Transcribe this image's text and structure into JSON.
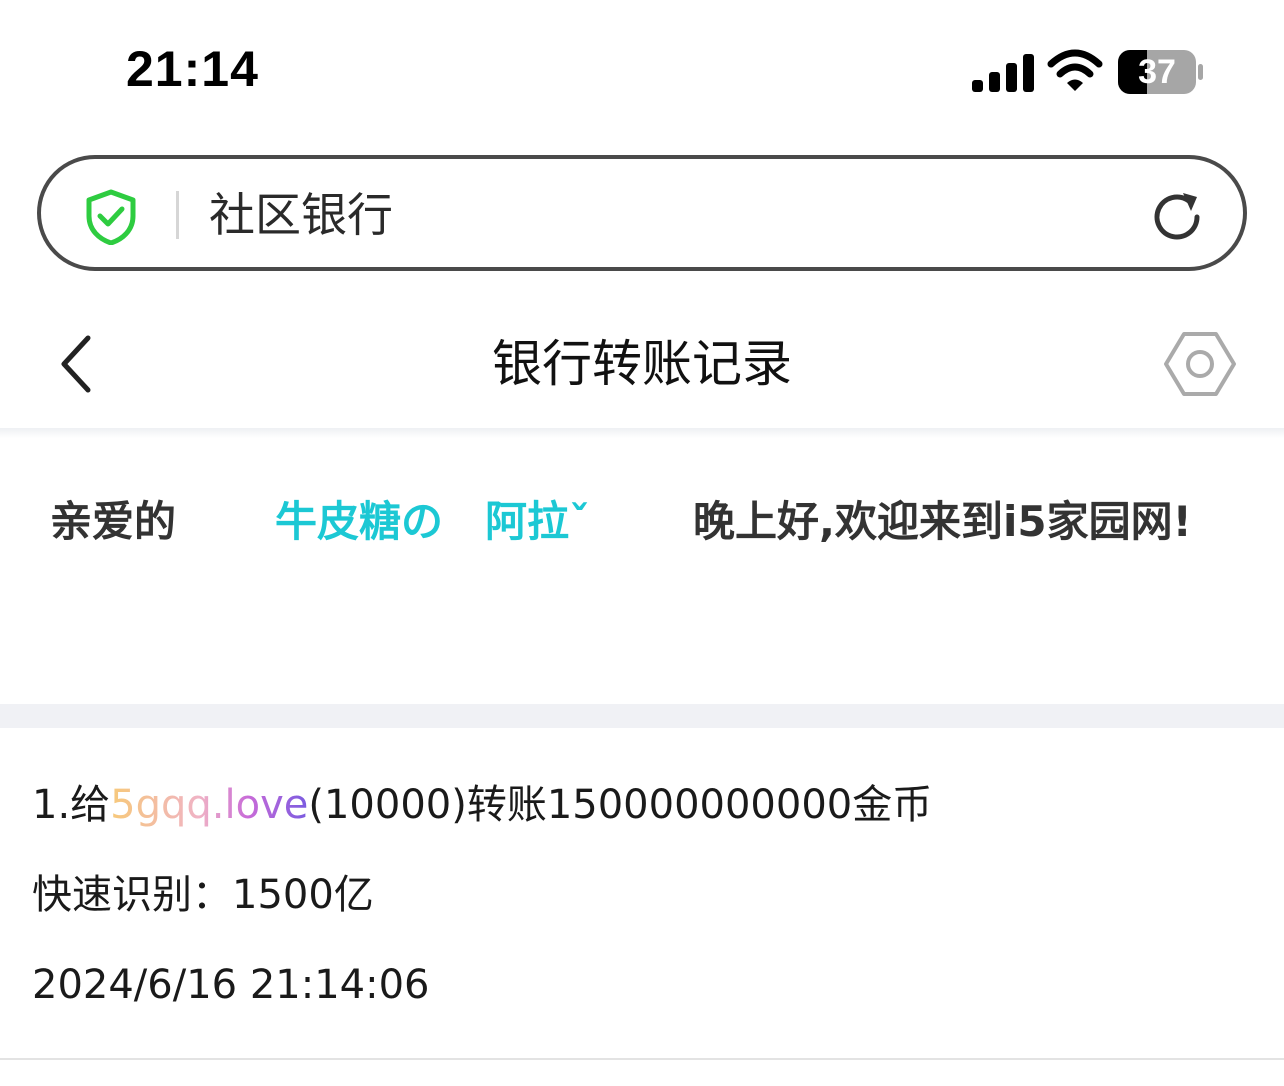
{
  "status_bar": {
    "time": "21:14",
    "battery": "37",
    "icons": [
      "signal-icon",
      "wifi-icon",
      "battery-icon"
    ]
  },
  "address_bar": {
    "text": "社区银行",
    "icons": [
      "shield-check-icon",
      "reload-icon"
    ],
    "accent_color": "#2ecc40"
  },
  "header": {
    "title": "银行转账记录",
    "icons": [
      "back-icon",
      "settings-icon"
    ]
  },
  "greeting": {
    "prefix": "亲爱的",
    "name": "牛皮糖の　阿拉ˇ",
    "suffix": "晚上好,欢迎来到i5家园网!",
    "name_color": "#1cc8d4"
  },
  "record": {
    "line1_prefix": "1.给",
    "recipient": "5gqq.love",
    "line1_suffix": "(10000)转账150000000000金币",
    "quick_label": "快速识别：1500亿",
    "timestamp": "2024/6/16 21:14:06"
  }
}
